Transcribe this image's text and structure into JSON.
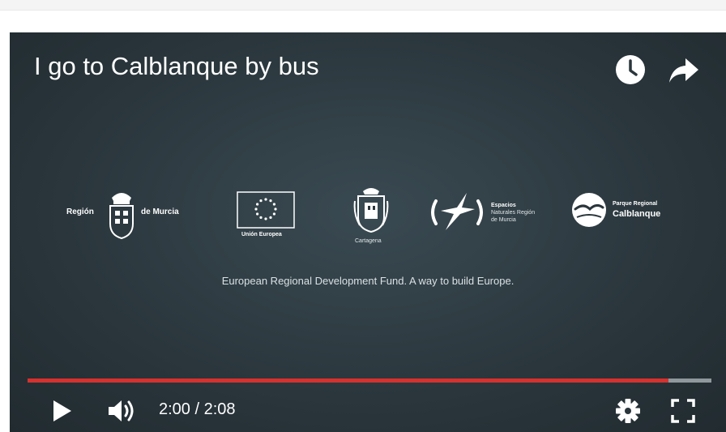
{
  "video": {
    "title": "I go to Calblanque by bus",
    "current_time": "2:00",
    "separator": "/",
    "duration": "2:08",
    "progress": 0.9375,
    "tagline": "European Regional Development Fund. A way to build Europe."
  },
  "logos": {
    "region": {
      "left": "Región",
      "right": "de Murcia"
    },
    "eu": {
      "label": "Unión Europea"
    },
    "cartagena": {
      "label": "Cartagena"
    },
    "espacios": {
      "line1": "Espacios",
      "line2": "Naturales Región",
      "line3": "de Murcia"
    },
    "calblanque": {
      "line1": "Parque Regional",
      "line2": "Calblanque"
    }
  },
  "icons": {
    "watch_later": "clock-icon",
    "share": "share-arrow-icon",
    "play": "play-icon",
    "volume": "volume-icon",
    "settings": "gear-icon",
    "fullscreen": "fullscreen-icon"
  },
  "colors": {
    "progress": "#d6312f",
    "track": "#8f989c",
    "background": "#2a363c"
  }
}
